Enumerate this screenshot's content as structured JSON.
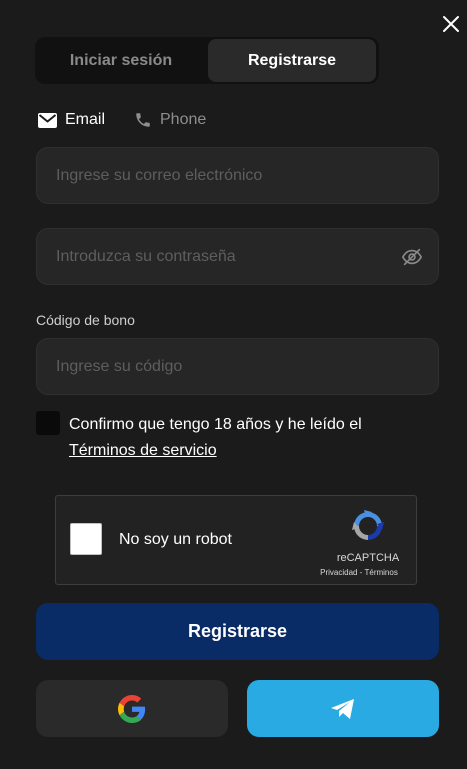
{
  "tabs": {
    "login": "Iniciar sesión",
    "register": "Registrarse",
    "active": "register"
  },
  "method": {
    "email_label": "Email",
    "phone_label": "Phone",
    "active": "email",
    "email_icon": "envelope-icon",
    "phone_icon": "phone-icon"
  },
  "form": {
    "email_placeholder": "Ingrese su correo electrónico",
    "email_value": "",
    "password_placeholder": "Introduzca su contraseña",
    "password_value": "",
    "password_toggle_icon": "eye-off-icon",
    "bonus_label": "Código de bono",
    "bonus_placeholder": "Ingrese su código",
    "bonus_value": ""
  },
  "terms": {
    "text": "Confirmo que tengo 18 años y he leído el",
    "link": "Términos de servicio",
    "checked": false
  },
  "recaptcha": {
    "label": "No soy un robot",
    "brand": "reCAPTCHA",
    "privacy": "Privacidad",
    "separator": " - ",
    "terms": "Términos",
    "checked": false
  },
  "submit_label": "Registrarse",
  "social": {
    "google_icon": "google-icon",
    "telegram_icon": "telegram-icon"
  },
  "colors": {
    "background": "#1b1b1c",
    "field": "#262626",
    "submit": "#0a2c66",
    "telegram": "#29aae2",
    "google_button": "#2a2a2a"
  }
}
